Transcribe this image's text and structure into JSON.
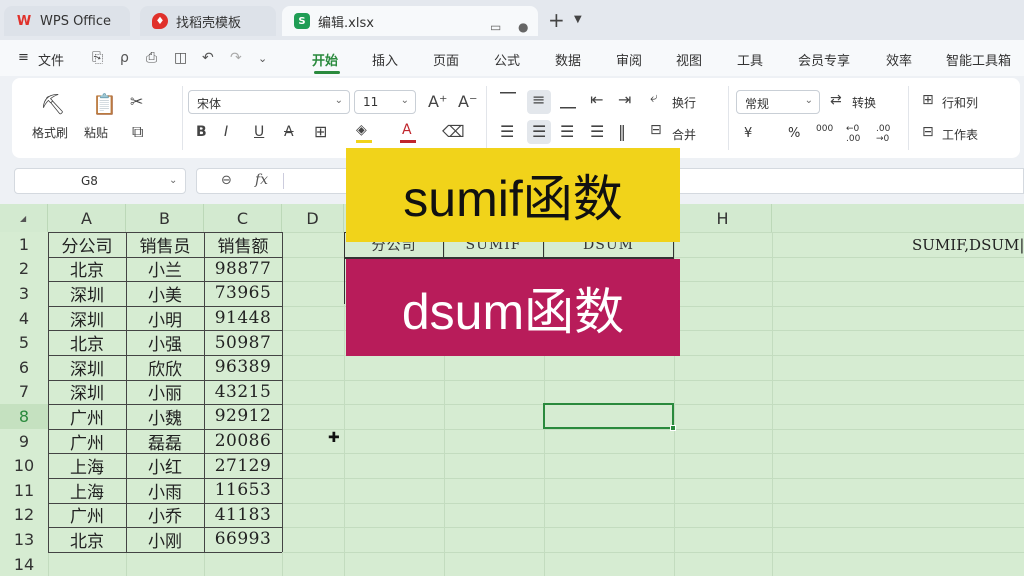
{
  "tabs": {
    "wps": "WPS Office",
    "template": "找稻壳模板",
    "file": "编辑.xlsx"
  },
  "menu": {
    "file": "文件",
    "tabs": [
      "开始",
      "插入",
      "页面",
      "公式",
      "数据",
      "审阅",
      "视图",
      "工具",
      "会员专享",
      "效率",
      "智能工具箱"
    ]
  },
  "ribbon": {
    "format_painter": "格式刷",
    "paste": "粘贴",
    "font_name": "宋体",
    "font_size": "11",
    "wrap": "换行",
    "number_format": "常规",
    "convert": "转换",
    "rows_cols": "行和列",
    "merge": "合并",
    "sheet": "工作表",
    "currency": "¥",
    "percent": "%",
    "thousands": "000",
    "inc_dec": "←0 .00",
    "dec_dec": ".00 →0"
  },
  "formula_bar": {
    "name_box": "G8",
    "fx": "fx"
  },
  "columns": [
    "A",
    "B",
    "C",
    "D",
    "E",
    "F",
    "G",
    "H"
  ],
  "rows": [
    "1",
    "2",
    "3",
    "4",
    "5",
    "6",
    "7",
    "8",
    "9",
    "10",
    "11",
    "12",
    "13",
    "14"
  ],
  "table": {
    "headers": [
      "分公司",
      "销售员",
      "销售额"
    ],
    "rows": [
      [
        "北京",
        "小兰",
        "98877"
      ],
      [
        "深圳",
        "小美",
        "73965"
      ],
      [
        "深圳",
        "小明",
        "91448"
      ],
      [
        "北京",
        "小强",
        "50987"
      ],
      [
        "深圳",
        "欣欣",
        "96389"
      ],
      [
        "深圳",
        "小丽",
        "43215"
      ],
      [
        "广州",
        "小魏",
        "92912"
      ],
      [
        "广州",
        "磊磊",
        "20086"
      ],
      [
        "上海",
        "小红",
        "27129"
      ],
      [
        "上海",
        "小雨",
        "11653"
      ],
      [
        "广州",
        "小乔",
        "41183"
      ],
      [
        "北京",
        "小刚",
        "66993"
      ]
    ]
  },
  "summary_headers": [
    "分公司",
    "SUMIF",
    "DSUM"
  ],
  "note": "SUMIF,DSUM|",
  "overlay": {
    "sumif": "sumif函数",
    "dsum": "dsum函数"
  },
  "colors": {
    "accent": "#2a8a3d",
    "grid_bg": "#d6ecd2",
    "sumif_bg": "#f1d31a",
    "dsum_bg": "#b81c5a"
  }
}
